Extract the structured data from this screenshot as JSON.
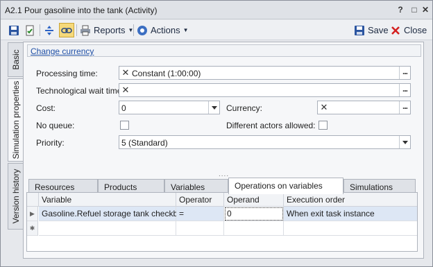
{
  "window": {
    "title": "A2.1 Pour gasoline into the tank (Activity)",
    "controls": [
      "?",
      "□",
      "✕"
    ]
  },
  "toolbar": {
    "reports_label": "Reports",
    "actions_label": "Actions",
    "save_label": "Save",
    "close_label": "Close"
  },
  "side_tabs": [
    "Basic",
    "Simulation properties",
    "Version history"
  ],
  "form": {
    "link": "Change currency",
    "processing_time_label": "Processing time:",
    "processing_time_value": "Constant (1:00:00)",
    "wait_time_label": "Technological wait time:",
    "wait_time_value": "",
    "cost_label": "Cost:",
    "cost_value": "0",
    "currency_label": "Currency:",
    "currency_value": "",
    "no_queue_label": "No queue:",
    "different_actors_label": "Different actors allowed:",
    "priority_label": "Priority:",
    "priority_value": "5 (Standard)",
    "splitter": "....",
    "clear_glyph": "✕",
    "dots_glyph": "..."
  },
  "bottom_tabs": [
    "Resources",
    "Products",
    "Variables",
    "Operations on variables",
    "Simulations"
  ],
  "grid": {
    "columns": [
      "Variable",
      "Operator",
      "Operand",
      "Execution order"
    ],
    "rows": [
      {
        "variable": "Gasoline.Refuel storage tank checkbox",
        "operator": "=",
        "operand": "0",
        "order": "When exit task instance"
      }
    ],
    "row_marker": "▶",
    "new_row_marker": "✱"
  },
  "colors": {
    "accent_link": "#1f4fa5",
    "close_red": "#d42020",
    "selected_row": "#dde7f5"
  }
}
